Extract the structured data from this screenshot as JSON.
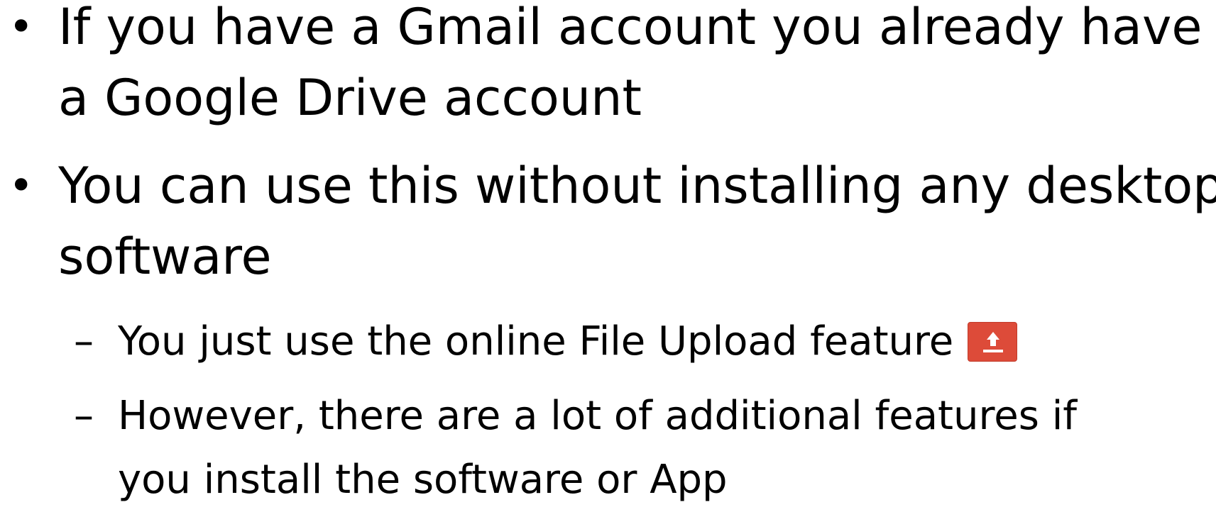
{
  "slide": {
    "bullets": [
      {
        "marker": "•",
        "lines": [
          "If you have a Gmail account you already have",
          "a Google Drive account"
        ]
      },
      {
        "marker": "•",
        "lines": [
          "You can use this without installing any desktop",
          "software"
        ]
      }
    ],
    "subbullets": [
      {
        "marker": "–",
        "lines": [
          "You just use the online File Upload feature"
        ],
        "icon": "upload-icon"
      },
      {
        "marker": "–",
        "lines": [
          "However, there are a lot of additional features if",
          "you install the software or App"
        ]
      }
    ]
  },
  "colors": {
    "upload_button": "#dd4b39"
  }
}
